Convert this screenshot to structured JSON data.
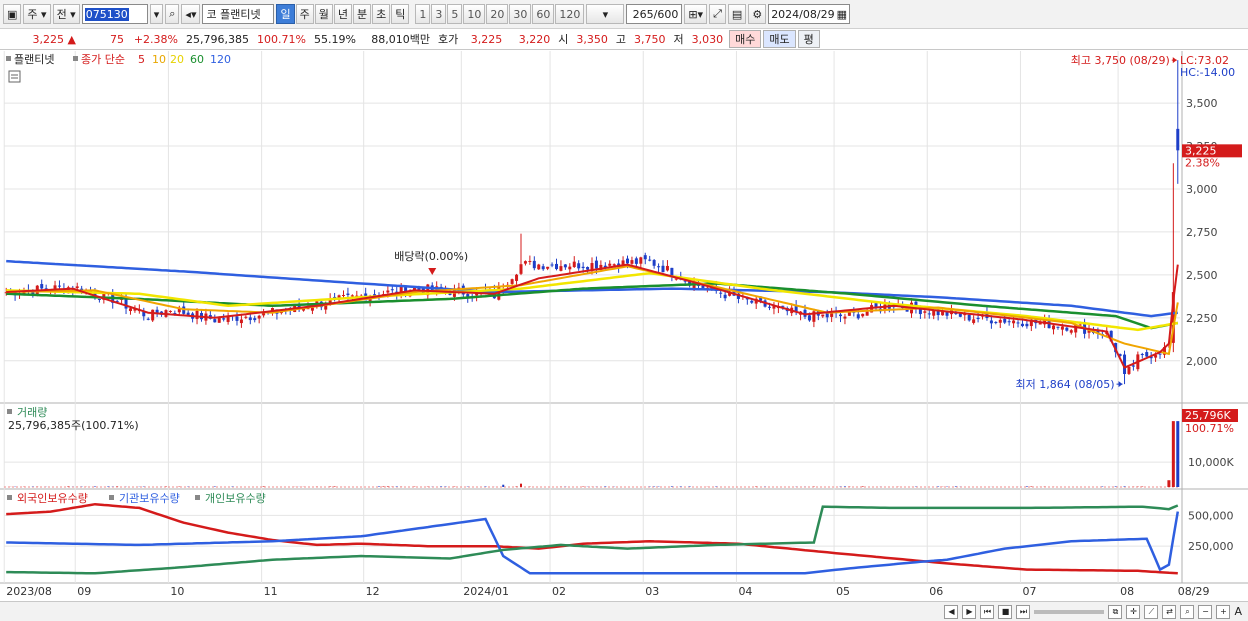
{
  "toolbar": {
    "period_label": "주",
    "prev_label": "전",
    "code": "075130",
    "market_label": "코",
    "stock_name": "플랜티넷",
    "periods": [
      "일",
      "주",
      "월",
      "년",
      "분",
      "초",
      "틱"
    ],
    "selected_period": "일",
    "intervals": [
      "1",
      "3",
      "5",
      "10",
      "20",
      "30",
      "60",
      "120"
    ],
    "count": "265",
    "count_max": "/600",
    "date": "2024/08/29"
  },
  "quote": {
    "price": "3,225",
    "arrow": "▲",
    "change": "75",
    "change_pct": "+2.38%",
    "volume": "25,796,385",
    "volume_ratio": "100.71%",
    "rate": "55.19%",
    "amount": "88,010백만",
    "hoga_label": "호가",
    "ask": "3,225",
    "bid": "3,220",
    "open_label": "시",
    "open": "3,350",
    "high_label": "고",
    "high": "3,750",
    "low_label": "저",
    "low": "3,030",
    "buy_label": "매수",
    "sell_label": "매도",
    "avg_label": "평"
  },
  "legend_price": {
    "name": "플랜티넷",
    "close_label": "종가 단순",
    "ma": [
      {
        "label": "5",
        "color": "#d41b1b"
      },
      {
        "label": "10",
        "color": "#e8a700"
      },
      {
        "label": "20",
        "color": "#e6d200"
      },
      {
        "label": "60",
        "color": "#1a8f2e"
      },
      {
        "label": "120",
        "color": "#2f5fe0"
      }
    ]
  },
  "annotations": {
    "high": "최고 3,750 (08/29)",
    "low": "최저 1,864 (08/05)",
    "dividend": "배당락(0.00%)",
    "lc": "LC:73.02",
    "hc": "HC:-14.00",
    "current_tag": "3,225",
    "current_pct": "2.38%",
    "volume_tag": "25,796K",
    "volume_pct": "100.71%",
    "volume_title": "거래량",
    "volume_value": "25,796,385주(100.71%)"
  },
  "legend_holders": [
    {
      "label": "외국인보유수량",
      "color": "#d41b1b"
    },
    {
      "label": "기관보유수량",
      "color": "#2f5fe0"
    },
    {
      "label": "개인보유수량",
      "color": "#2e8b57"
    }
  ],
  "colors": {
    "up": "#d41b1b",
    "down": "#1e3fc8",
    "ma5": "#d41b1b",
    "ma10": "#f0a500",
    "ma20": "#f2e600",
    "ma60": "#1a8f2e",
    "ma120": "#2f5fe0",
    "foreign": "#d41b1b",
    "institution": "#2f5fe0",
    "individual": "#2e8b57"
  },
  "chart_data": [
    {
      "type": "line",
      "title": "플랜티넷 일봉",
      "y_ticks": [
        2000,
        2250,
        2500,
        2750,
        3000,
        3250,
        3500
      ],
      "y_tick_labels": [
        "2,000",
        "2,250",
        "2,500",
        "2,750",
        "3,000",
        "3,250",
        "3,500"
      ],
      "ylim": [
        1760,
        3780
      ],
      "x_tick_labels": [
        "2023/08",
        "09",
        "10",
        "11",
        "12",
        "2024/01",
        "02",
        "03",
        "04",
        "05",
        "06",
        "07",
        "08",
        "08/29"
      ],
      "x_tick_pos": [
        0,
        16,
        37,
        58,
        81,
        103,
        123,
        144,
        165,
        187,
        208,
        229,
        251,
        264
      ],
      "n_days": 265,
      "close_key": [
        [
          0,
          2400
        ],
        [
          15,
          2430
        ],
        [
          24,
          2360
        ],
        [
          32,
          2260
        ],
        [
          37,
          2300
        ],
        [
          47,
          2240
        ],
        [
          58,
          2270
        ],
        [
          70,
          2330
        ],
        [
          81,
          2380
        ],
        [
          92,
          2420
        ],
        [
          103,
          2400
        ],
        [
          110,
          2380
        ],
        [
          116,
          2560
        ],
        [
          130,
          2560
        ],
        [
          140,
          2570
        ],
        [
          145,
          2580
        ],
        [
          156,
          2440
        ],
        [
          165,
          2360
        ],
        [
          180,
          2260
        ],
        [
          190,
          2260
        ],
        [
          200,
          2330
        ],
        [
          208,
          2290
        ],
        [
          218,
          2250
        ],
        [
          229,
          2230
        ],
        [
          240,
          2200
        ],
        [
          248,
          2160
        ],
        [
          251,
          2020
        ],
        [
          252,
          1900
        ],
        [
          255,
          2010
        ],
        [
          260,
          2060
        ],
        [
          262,
          2100
        ],
        [
          263,
          2400
        ],
        [
          264,
          3225
        ]
      ],
      "ma5_key": [
        [
          0,
          2400
        ],
        [
          15,
          2420
        ],
        [
          32,
          2280
        ],
        [
          47,
          2250
        ],
        [
          70,
          2320
        ],
        [
          92,
          2410
        ],
        [
          110,
          2390
        ],
        [
          120,
          2480
        ],
        [
          140,
          2560
        ],
        [
          156,
          2450
        ],
        [
          180,
          2270
        ],
        [
          200,
          2320
        ],
        [
          229,
          2240
        ],
        [
          248,
          2170
        ],
        [
          252,
          1960
        ],
        [
          260,
          2050
        ],
        [
          262,
          2100
        ],
        [
          263,
          2350
        ],
        [
          264,
          2560
        ]
      ],
      "ma10_key": [
        [
          0,
          2400
        ],
        [
          20,
          2410
        ],
        [
          40,
          2300
        ],
        [
          60,
          2280
        ],
        [
          92,
          2400
        ],
        [
          116,
          2440
        ],
        [
          140,
          2550
        ],
        [
          160,
          2430
        ],
        [
          185,
          2280
        ],
        [
          210,
          2310
        ],
        [
          240,
          2220
        ],
        [
          252,
          2100
        ],
        [
          262,
          2040
        ],
        [
          264,
          2340
        ]
      ],
      "ma20_key": [
        [
          0,
          2410
        ],
        [
          30,
          2390
        ],
        [
          50,
          2320
        ],
        [
          80,
          2370
        ],
        [
          116,
          2420
        ],
        [
          145,
          2510
        ],
        [
          170,
          2420
        ],
        [
          200,
          2330
        ],
        [
          230,
          2260
        ],
        [
          255,
          2180
        ],
        [
          264,
          2220
        ]
      ],
      "ma60_key": [
        [
          0,
          2390
        ],
        [
          30,
          2360
        ],
        [
          60,
          2320
        ],
        [
          100,
          2360
        ],
        [
          130,
          2420
        ],
        [
          160,
          2450
        ],
        [
          190,
          2390
        ],
        [
          220,
          2320
        ],
        [
          250,
          2260
        ],
        [
          258,
          2190
        ],
        [
          264,
          2220
        ]
      ],
      "ma120_key": [
        [
          0,
          2580
        ],
        [
          40,
          2520
        ],
        [
          80,
          2450
        ],
        [
          110,
          2400
        ],
        [
          150,
          2420
        ],
        [
          185,
          2400
        ],
        [
          210,
          2370
        ],
        [
          240,
          2320
        ],
        [
          258,
          2260
        ],
        [
          264,
          2280
        ]
      ],
      "high": {
        "day": 264,
        "value": 3750,
        "date": "08/29"
      },
      "low": {
        "day": 252,
        "value": 1864,
        "date": "08/05"
      },
      "dividend_day": 96
    },
    {
      "type": "bar",
      "title": "거래량",
      "ylim": [
        0,
        27000
      ],
      "y_ticks": [
        10000
      ],
      "y_tick_labels": [
        "10,000K"
      ],
      "spikes": [
        {
          "day": 263,
          "value": 25796
        },
        {
          "day": 264,
          "value": 25796
        },
        {
          "day": 262,
          "value": 3000
        }
      ]
    },
    {
      "type": "line",
      "title": "보유수량",
      "ylim": [
        0,
        600000
      ],
      "y_ticks": [
        250000,
        500000
      ],
      "y_tick_labels": [
        "250,000",
        "500,000"
      ],
      "series": [
        {
          "name": "외국인보유수량",
          "points": [
            [
              0,
              510000
            ],
            [
              10,
              530000
            ],
            [
              20,
              590000
            ],
            [
              30,
              560000
            ],
            [
              40,
              440000
            ],
            [
              50,
              360000
            ],
            [
              60,
              300000
            ],
            [
              70,
              260000
            ],
            [
              80,
              270000
            ],
            [
              95,
              250000
            ],
            [
              110,
              250000
            ],
            [
              120,
              230000
            ],
            [
              130,
              270000
            ],
            [
              145,
              290000
            ],
            [
              165,
              270000
            ],
            [
              185,
              200000
            ],
            [
              200,
              150000
            ],
            [
              212,
              110000
            ],
            [
              230,
              60000
            ],
            [
              255,
              50000
            ],
            [
              264,
              30000
            ]
          ]
        },
        {
          "name": "기관보유수량",
          "points": [
            [
              0,
              280000
            ],
            [
              30,
              260000
            ],
            [
              60,
              290000
            ],
            [
              80,
              330000
            ],
            [
              100,
              430000
            ],
            [
              108,
              470000
            ],
            [
              112,
              170000
            ],
            [
              118,
              30000
            ],
            [
              140,
              30000
            ],
            [
              180,
              30000
            ],
            [
              190,
              70000
            ],
            [
              205,
              120000
            ],
            [
              212,
              140000
            ],
            [
              225,
              230000
            ],
            [
              240,
              290000
            ],
            [
              257,
              310000
            ],
            [
              260,
              60000
            ],
            [
              262,
              100000
            ],
            [
              264,
              530000
            ]
          ]
        },
        {
          "name": "개인보유수량",
          "points": [
            [
              0,
              40000
            ],
            [
              20,
              30000
            ],
            [
              40,
              80000
            ],
            [
              60,
              140000
            ],
            [
              80,
              170000
            ],
            [
              100,
              150000
            ],
            [
              112,
              220000
            ],
            [
              125,
              260000
            ],
            [
              140,
              230000
            ],
            [
              160,
              260000
            ],
            [
              182,
              280000
            ],
            [
              184,
              570000
            ],
            [
              200,
              560000
            ],
            [
              230,
              560000
            ],
            [
              256,
              570000
            ],
            [
              262,
              550000
            ],
            [
              264,
              580000
            ]
          ]
        }
      ]
    }
  ],
  "nav_label": "A"
}
